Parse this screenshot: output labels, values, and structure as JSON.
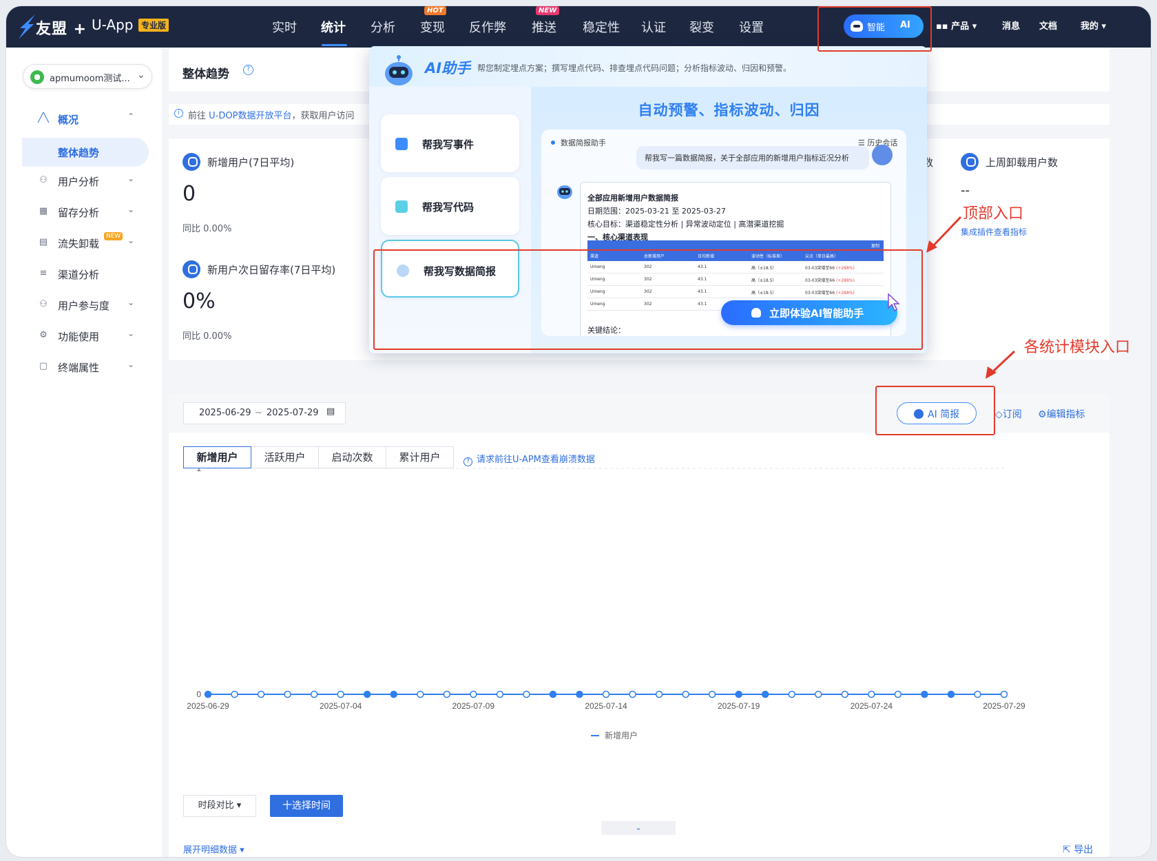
{
  "topnav": {
    "brand": "友盟 +",
    "app": "U-App",
    "edition_badge": "专业版",
    "items": [
      {
        "label": "实时",
        "badge": ""
      },
      {
        "label": "统计",
        "badge": "",
        "active": true
      },
      {
        "label": "分析",
        "badge": ""
      },
      {
        "label": "变现",
        "badge": "HOT"
      },
      {
        "label": "反作弊",
        "badge": ""
      },
      {
        "label": "推送",
        "badge": "NEW"
      },
      {
        "label": "稳定性",
        "badge": ""
      },
      {
        "label": "认证",
        "badge": ""
      },
      {
        "label": "裂变",
        "badge": ""
      },
      {
        "label": "设置",
        "badge": ""
      }
    ],
    "ai_pill": {
      "text1": "智能",
      "text2": "AI"
    },
    "right": {
      "products": "产品",
      "messages": "消息",
      "docs": "文档",
      "mine": "我的"
    }
  },
  "sidebar": {
    "app_selector": "apmumoom测试...",
    "items": [
      {
        "label": "概况",
        "icon": "chart-icon",
        "open": true
      },
      {
        "label": "用户分析",
        "icon": "user-icon"
      },
      {
        "label": "留存分析",
        "icon": "calendar-icon"
      },
      {
        "label": "流失卸载",
        "icon": "uninstall-icon",
        "badge": "NEW"
      },
      {
        "label": "渠道分析",
        "icon": "channel-icon"
      },
      {
        "label": "用户参与度",
        "icon": "engage-icon"
      },
      {
        "label": "功能使用",
        "icon": "gear-icon"
      },
      {
        "label": "终端属性",
        "icon": "device-icon"
      }
    ],
    "sub_item": "整体趋势"
  },
  "page": {
    "title": "整体趋势",
    "notice_prefix": "前往",
    "notice_link": "U-DOP数据开放平台",
    "notice_suffix": "，获取用户访问"
  },
  "metrics": {
    "new_users_label": "新增用户(7日平均)",
    "new_users_value": "0",
    "new_users_yoy": "同比 0.00%",
    "retention_label": "新用户次日留存率(7日平均)",
    "retention_value": "0%",
    "retention_yoy": "同比 0.00%",
    "partial_label": "数",
    "uninstall_label": "上周卸载用户数",
    "uninstall_value": "--",
    "uninstall_link": "集成插件查看指标"
  },
  "chart_panel": {
    "date_start": "2025-06-29",
    "date_sep": "~",
    "date_end": "2025-07-29",
    "ai_brief": "AI 简报",
    "subscribe": "订阅",
    "edit_metrics": "编辑指标",
    "tabs": [
      "新增用户",
      "活跃用户",
      "启动次数",
      "累计用户"
    ],
    "apm_link": "请求前往U-APM查看崩溃数据",
    "period_compare": "时段对比",
    "select_time": "十选择时间",
    "expand": "展开明细数据",
    "export": "导出"
  },
  "chart_data": {
    "type": "line",
    "x": [
      "2025-06-29",
      "2025-06-30",
      "2025-07-01",
      "2025-07-02",
      "2025-07-03",
      "2025-07-04",
      "2025-07-05",
      "2025-07-06",
      "2025-07-07",
      "2025-07-08",
      "2025-07-09",
      "2025-07-10",
      "2025-07-11",
      "2025-07-12",
      "2025-07-13",
      "2025-07-14",
      "2025-07-15",
      "2025-07-16",
      "2025-07-17",
      "2025-07-18",
      "2025-07-19",
      "2025-07-20",
      "2025-07-21",
      "2025-07-22",
      "2025-07-23",
      "2025-07-24",
      "2025-07-25",
      "2025-07-26",
      "2025-07-27",
      "2025-07-28",
      "2025-07-29"
    ],
    "xticks": [
      "2025-06-29",
      "2025-07-04",
      "2025-07-09",
      "2025-07-14",
      "2025-07-19",
      "2025-07-24",
      "2025-07-29"
    ],
    "filled": [
      true,
      false,
      false,
      false,
      false,
      false,
      true,
      true,
      false,
      false,
      false,
      false,
      false,
      true,
      true,
      false,
      false,
      false,
      false,
      false,
      true,
      true,
      false,
      false,
      false,
      false,
      false,
      true,
      true,
      false,
      false
    ],
    "series": [
      {
        "name": "新增用户",
        "values": [
          0,
          0,
          0,
          0,
          0,
          0,
          0,
          0,
          0,
          0,
          0,
          0,
          0,
          0,
          0,
          0,
          0,
          0,
          0,
          0,
          0,
          0,
          0,
          0,
          0,
          0,
          0,
          0,
          0,
          0,
          0
        ]
      }
    ],
    "yticks": [
      "0",
      "1"
    ],
    "ylim": [
      0,
      1
    ],
    "legend": "bottom-center",
    "grid": true,
    "color": "#2f7ff0"
  },
  "ai_popup": {
    "title": "AI助手",
    "desc": "帮您制定埋点方案；撰写埋点代码、排查埋点代码问题；分析指标波动、归因和预警。",
    "features": [
      "帮我写事件",
      "帮我写代码",
      "帮我写数据简报"
    ],
    "headline": "自动预警、指标波动、归因",
    "chat_title": "数据简报助手",
    "history": "历史会话",
    "user_msg": "帮我写一篇数据简报，关于全部应用的新增用户指标近况分析",
    "report": {
      "title": "全部应用新增用户数据简报",
      "date": "日期范围：2025-03-21 至 2025-03-27",
      "goal": "核心目标：渠道稳定性分析 | 异常波动定位 | 高潜渠道挖掘",
      "section": "一、核心渠道表现",
      "copy": "复制",
      "columns": [
        "渠道",
        "总新增用户",
        "日均新增",
        "波动性（标准差）",
        "尖点（单日最高）"
      ],
      "rows": [
        [
          "Umeng",
          "302",
          "43.1",
          "高（±18.5）",
          "03-03突增至66",
          "(+288%)"
        ],
        [
          "Umeng",
          "302",
          "43.1",
          "高（±18.5）",
          "03-03突增至66",
          "(+288%)"
        ],
        [
          "Umeng",
          "302",
          "43.1",
          "高（±18.5）",
          "03-03突增至66",
          "(+288%)"
        ],
        [
          "Umeng",
          "302",
          "43.1",
          "高（±18.5）",
          "03-03突增至66",
          "(+288%)"
        ]
      ],
      "conclusion": "关键结论："
    },
    "cta": "立即体验AI智能助手"
  },
  "annotations": {
    "top_entry": "顶部入口",
    "module_entry": "各统计模块入口"
  }
}
